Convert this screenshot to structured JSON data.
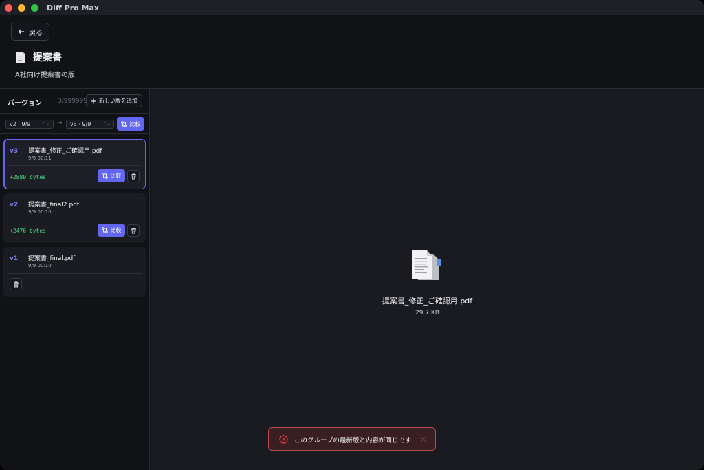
{
  "app": {
    "title": "Diff Pro Max"
  },
  "header": {
    "back_label": "戻る",
    "title": "提案書",
    "subtitle": "A社向け提案書の版"
  },
  "sidebar": {
    "title": "バージョン",
    "count": "3/999999",
    "add_label": "新しい版を追加",
    "compare_from": "v2 · 9/9",
    "compare_to": "v3 · 9/9",
    "compare_label": "比較",
    "versions": [
      {
        "tag": "v3",
        "name": "提案書_修正_ご確認用.pdf",
        "time": "9/9 00:11",
        "delta": "+2889 bytes",
        "compare_label": "比較",
        "active": true
      },
      {
        "tag": "v2",
        "name": "提案書_final2.pdf",
        "time": "9/9 00:10",
        "delta": "+2476 bytes",
        "compare_label": "比較",
        "active": false
      },
      {
        "tag": "v1",
        "name": "提案書_final.pdf",
        "time": "9/9 00:10",
        "active": false
      }
    ]
  },
  "preview": {
    "file_name": "提案書_修正_ご確認用.pdf",
    "file_size": "29.7 KB"
  },
  "toast": {
    "message": "このグループの最新版と内容が同じです"
  },
  "colors": {
    "accent": "#6366f1",
    "positive": "#4ade80",
    "error": "#e5484d"
  }
}
